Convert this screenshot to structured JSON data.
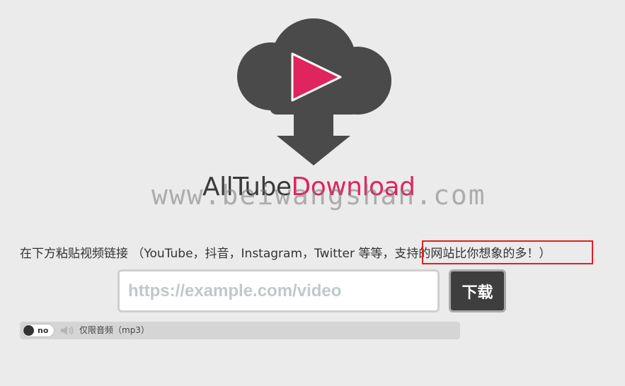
{
  "brand": {
    "part1": "AllTube",
    "part2": "Download"
  },
  "watermark": "www.beiwangshan.com",
  "intro": {
    "text": "在下方粘贴视频链接 （YouTube，抖音，Instagram，Twitter 等等，",
    "highlight": "支持的网站比你想象的多！",
    "closing": "）"
  },
  "form": {
    "url_placeholder": "https://example.com/video",
    "url_value": "",
    "download_label": "下载"
  },
  "audio_only": {
    "toggle_label": "no",
    "text": "仅限音频（mp3）"
  },
  "colors": {
    "accent": "#e0245e",
    "cloud": "#4a4a4a",
    "highlight_border": "#e02020"
  },
  "icons": {
    "logo": "cloud-download-play-icon",
    "speaker": "speaker-icon"
  }
}
